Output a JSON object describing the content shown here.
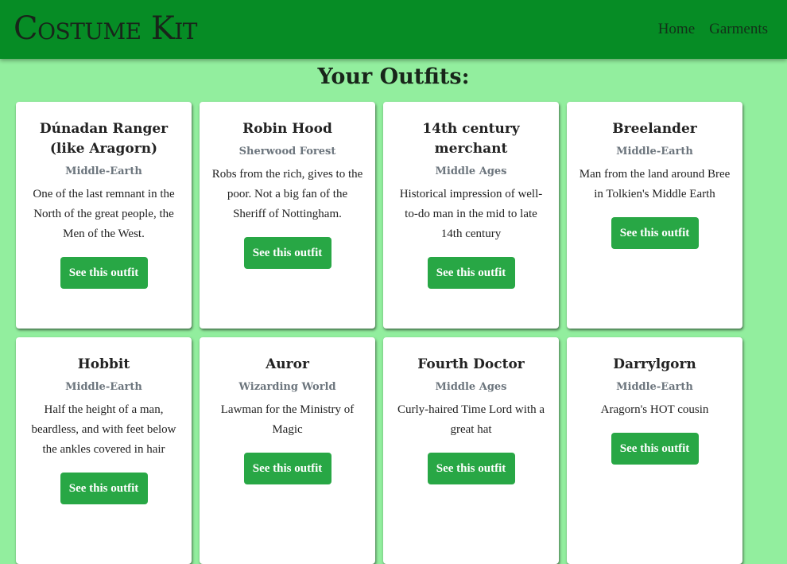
{
  "nav": {
    "brand": "Costume Kit",
    "links": [
      "Home",
      "Garments"
    ]
  },
  "page": {
    "title": "Your Outfits:"
  },
  "outfits": [
    {
      "title": "Dúnadan Ranger (like Aragorn)",
      "setting": "Middle-Earth",
      "description": "One of the last remnant in the North of the great people, the Men of the West.",
      "button": "See this outfit"
    },
    {
      "title": "Robin Hood",
      "setting": "Sherwood Forest",
      "description": "Robs from the rich, gives to the poor. Not a big fan of the Sheriff of Nottingham.",
      "button": "See this outfit"
    },
    {
      "title": "14th century merchant",
      "setting": "Middle Ages",
      "description": "Historical impression of well-to-do man in the mid to late 14th century",
      "button": "See this outfit"
    },
    {
      "title": "Breelander",
      "setting": "Middle-Earth",
      "description": "Man from the land around Bree in Tolkien's Middle Earth",
      "button": "See this outfit"
    },
    {
      "title": "Hobbit",
      "setting": "Middle-Earth",
      "description": "Half the height of a man, beardless, and with feet below the ankles covered in hair",
      "button": "See this outfit"
    },
    {
      "title": "Auror",
      "setting": "Wizarding World",
      "description": "Lawman for the Ministry of Magic",
      "button": "See this outfit"
    },
    {
      "title": "Fourth Doctor",
      "setting": "Middle Ages",
      "description": "Curly-haired Time Lord with a great hat",
      "button": "See this outfit"
    },
    {
      "title": "Darrylgorn",
      "setting": "Middle-Earth",
      "description": "Aragorn's HOT cousin",
      "button": "See this outfit"
    }
  ]
}
